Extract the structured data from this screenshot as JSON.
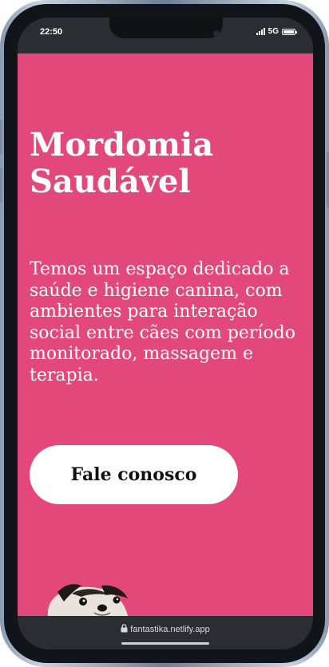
{
  "status_bar": {
    "time": "22:50",
    "network": "5G",
    "icons": [
      "signal-icon",
      "battery-icon"
    ]
  },
  "hero": {
    "title_line1": "Mordomia",
    "title_line2": "Saudável",
    "description": "Temos um espaço dedicado a saúde e higiene canina, com ambientes para interação social entre cães com período monitorado, massagem e terapia.",
    "cta_label": "Fale conosco"
  },
  "browser": {
    "url": "fantastika.netlify.app",
    "icons": [
      "lock-icon"
    ]
  },
  "colors": {
    "accent": "#e2497a",
    "chrome": "#2a2d31",
    "text_on_accent": "#ffffff",
    "button_bg": "#ffffff",
    "button_text": "#111111"
  }
}
